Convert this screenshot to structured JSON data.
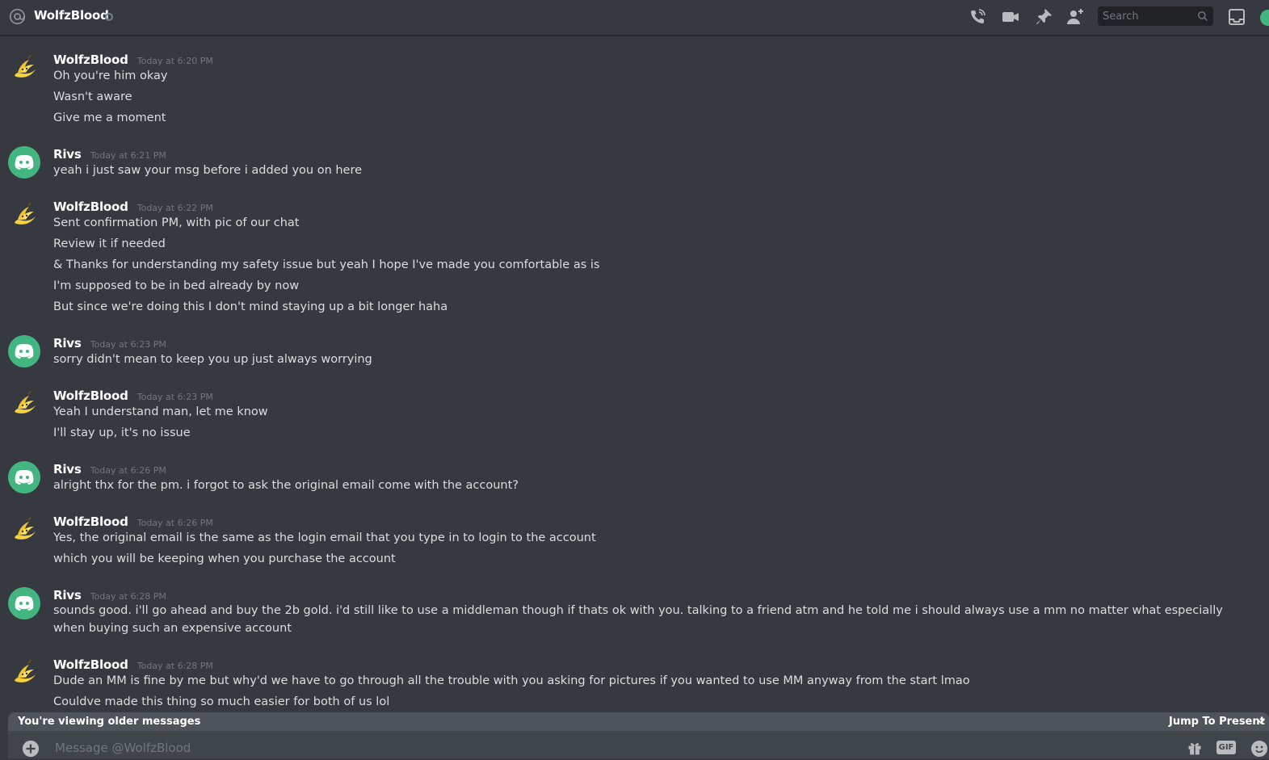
{
  "header": {
    "channel_name": "WolfzBlood",
    "search_placeholder": "Search"
  },
  "messages": [
    {
      "author": "WolfzBlood",
      "avatar": "banana",
      "timestamp": "Today at 6:20 PM",
      "lines": [
        "Oh you're him okay",
        "Wasn't aware",
        "Give me a moment"
      ]
    },
    {
      "author": "Rivs",
      "avatar": "discord",
      "timestamp": "Today at 6:21 PM",
      "lines": [
        "yeah i just saw your msg before i added you on here"
      ]
    },
    {
      "author": "WolfzBlood",
      "avatar": "banana",
      "timestamp": "Today at 6:22 PM",
      "lines": [
        "Sent confirmation PM, with pic of our chat",
        "Review it if needed",
        "& Thanks for understanding my safety issue but yeah I hope I've made you comfortable as is",
        "I'm supposed to be in bed already by now",
        "But since we're doing this I don't mind staying up a bit longer haha"
      ]
    },
    {
      "author": "Rivs",
      "avatar": "discord",
      "timestamp": "Today at 6:23 PM",
      "lines": [
        "sorry didn't mean to keep you up just always worrying"
      ]
    },
    {
      "author": "WolfzBlood",
      "avatar": "banana",
      "timestamp": "Today at 6:23 PM",
      "lines": [
        "Yeah I understand man, let me know",
        "I'll stay up, it's no issue"
      ]
    },
    {
      "author": "Rivs",
      "avatar": "discord",
      "timestamp": "Today at 6:26 PM",
      "lines": [
        "alright thx for the pm. i forgot to ask the original email come with the account?"
      ]
    },
    {
      "author": "WolfzBlood",
      "avatar": "banana",
      "timestamp": "Today at 6:26 PM",
      "lines": [
        "Yes, the original email is the same as the login email that you type in to login to the account",
        "which you will be keeping when you purchase the account"
      ]
    },
    {
      "author": "Rivs",
      "avatar": "discord",
      "timestamp": "Today at 6:28 PM",
      "lines": [
        "sounds good. i'll go ahead and buy the 2b gold. i'd still like to use a middleman though if thats ok with you. talking to a friend atm and he told me i should always use a mm no matter what especially when buying such an expensive account"
      ]
    },
    {
      "author": "WolfzBlood",
      "avatar": "banana",
      "timestamp": "Today at 6:28 PM",
      "lines": [
        "Dude an MM is fine by me but why'd we have to go through all the trouble with you asking for pictures if you wanted to use MM anyway from the start lmao",
        "Couldve made this thing so much easier for both of us lol"
      ]
    }
  ],
  "older_bar": {
    "text": "You're viewing older messages",
    "jump_label": "Jump To Present"
  },
  "composer": {
    "placeholder": "Message @WolfzBlood",
    "gif_label": "GIF"
  }
}
